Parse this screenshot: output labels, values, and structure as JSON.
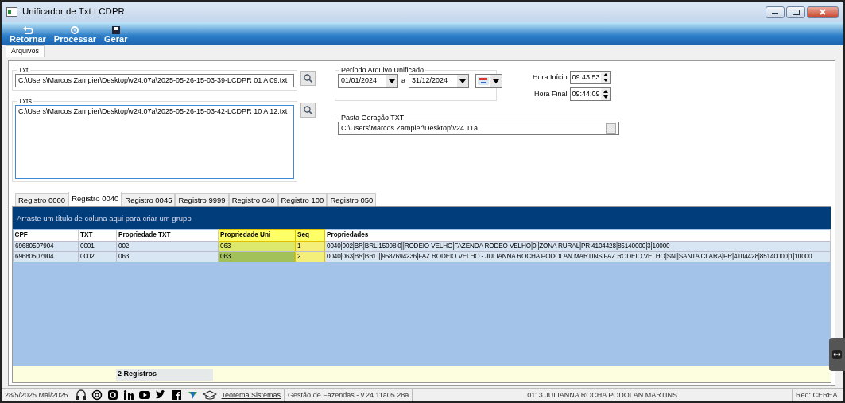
{
  "window": {
    "title": "Unificador de Txt LCDPR"
  },
  "toolbar": [
    {
      "label": "Retornar",
      "kind": "back"
    },
    {
      "label": "Processar",
      "kind": "process"
    },
    {
      "label": "Gerar",
      "kind": "save"
    }
  ],
  "page_tabs": [
    {
      "label": "Arquivos",
      "selected": true
    }
  ],
  "txt": {
    "legend": "Txt",
    "value": "C:\\Users\\Marcos Zampier\\Desktop\\v24.07a\\2025-05-26-15-03-39-LCDPR 01 A 09.txt"
  },
  "txts": {
    "legend": "Txts",
    "value": "C:\\Users\\Marcos Zampier\\Desktop\\v24.07a\\2025-05-26-15-03-42-LCDPR 10 A 12.txt"
  },
  "period": {
    "legend": "Período Arquivo Unificado",
    "from": "01/01/2024",
    "separator": "a",
    "to": "31/12/2024"
  },
  "start_time": {
    "label": "Hora Início",
    "value": "09:43:53"
  },
  "end_time": {
    "label": "Hora Final",
    "value": "09:44:09"
  },
  "output_folder": {
    "legend": "Pasta Geração TXT",
    "value": "C:\\Users\\Marcos Zampier\\Desktop\\v24.11a",
    "button": "..."
  },
  "grid_tabs": [
    {
      "label": "Registro 0000",
      "selected": false
    },
    {
      "label": "Registro 0040",
      "selected": true
    },
    {
      "label": "Registro 0045",
      "selected": false
    },
    {
      "label": "Registro 9999",
      "selected": false
    },
    {
      "label": "Registro 040",
      "selected": false
    },
    {
      "label": "Registro 100",
      "selected": false
    },
    {
      "label": "Registro 050",
      "selected": false
    }
  ],
  "group_panel": "Arraste um título de coluna aqui para criar um grupo",
  "columns": [
    {
      "label": "CPF",
      "highlighted": false
    },
    {
      "label": "TXT",
      "highlighted": false
    },
    {
      "label": "Propriedade TXT",
      "highlighted": false
    },
    {
      "label": "Propriedade Uni",
      "highlighted": true
    },
    {
      "label": "Seq",
      "highlighted": true
    },
    {
      "label": "Propriedades",
      "highlighted": false
    }
  ],
  "rows": [
    {
      "selected": false,
      "cells": [
        "69680507904",
        "0001",
        "002",
        "063",
        "1",
        "0040|002|BR|BRL|15098|0||RODEIO VELHO|FAZENDA RODEO VELHO|0||ZONA RURAL|PR|4104428|85140000|3|10000"
      ]
    },
    {
      "selected": true,
      "cells": [
        "69680507904",
        "0002",
        "063",
        "063",
        "2",
        "0040|063|BR|BRL|||9587694236|FAZ RODEIO VELHO - JULIANNA ROCHA PODOLAN MARTINS|FAZ RODEIO VELHO|SN||SANTA CLARA|PR|4104428|85140000|1|10000"
      ]
    }
  ],
  "footer": {
    "count": "2 Registros"
  },
  "status_bar": {
    "date": "28/5/2025 Mai/2025",
    "link": "Teorema Sistemas",
    "version": "Gestão de Fazendas - v.24.11a05.28a",
    "user": "0113 JULIANNA ROCHA PODOLAN MARTINS",
    "req": "Req: CEREA"
  }
}
